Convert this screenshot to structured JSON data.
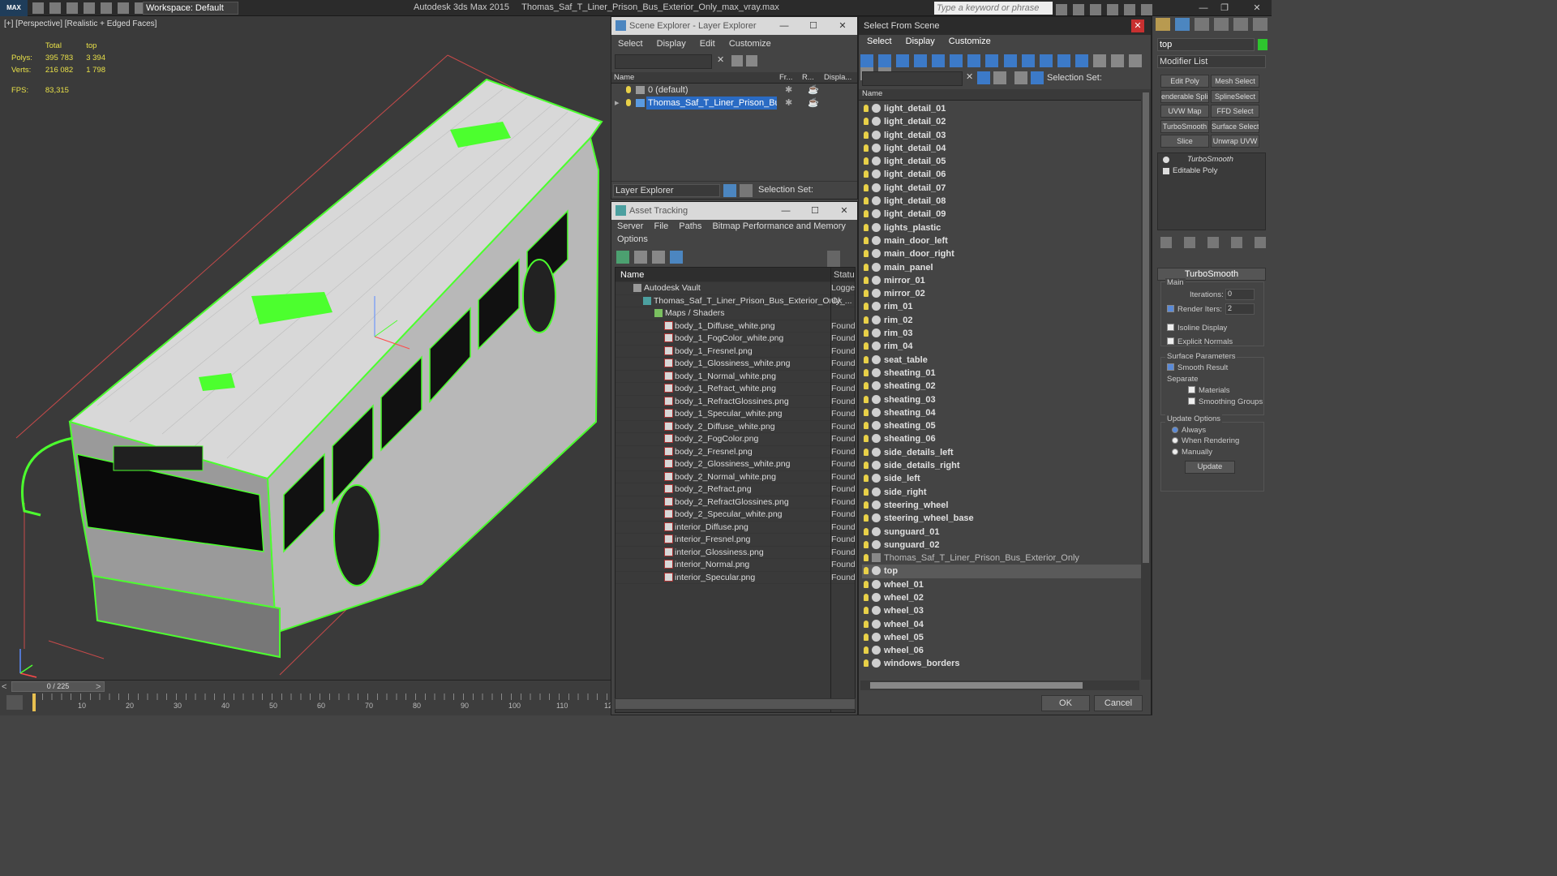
{
  "titlebar": {
    "logo": "MAX",
    "workspace": "Workspace: Default",
    "app_title": "Autodesk 3ds Max  2015",
    "file_title": "Thomas_Saf_T_Liner_Prison_Bus_Exterior_Only_max_vray.max",
    "search_placeholder": "Type a keyword or phrase"
  },
  "viewport": {
    "label": "[+] [Perspective] [Realistic + Edged Faces]",
    "stats": {
      "col_total": "Total",
      "col_top": "top",
      "polys_label": "Polys:",
      "polys_total": "395 783",
      "polys_top": "3 394",
      "verts_label": "Verts:",
      "verts_total": "216 082",
      "verts_top": "1 798",
      "fps_label": "FPS:",
      "fps_value": "83,315"
    }
  },
  "timeline": {
    "frame": "0 / 225",
    "ticks": [
      "10",
      "20",
      "30",
      "40",
      "50",
      "60",
      "70",
      "80",
      "90",
      "100",
      "110",
      "12"
    ]
  },
  "scene_explorer": {
    "title": "Scene Explorer - Layer Explorer",
    "menu": [
      "Select",
      "Display",
      "Edit",
      "Customize"
    ],
    "columns": [
      "Name",
      "Fr...",
      "R...",
      "Displa..."
    ],
    "rows": [
      "0 (default)",
      "Thomas_Saf_T_Liner_Prison_Bus_Ext..."
    ],
    "footer_dropdown": "Layer Explorer",
    "selection_set": "Selection Set:"
  },
  "asset_tracking": {
    "title": "Asset Tracking",
    "menu1": [
      "Server",
      "File",
      "Paths",
      "Bitmap Performance and Memory"
    ],
    "menu2": "Options",
    "col_name": "Name",
    "col_status": "Status",
    "vault": {
      "name": "Autodesk Vault",
      "status": "Logge"
    },
    "file": {
      "name": "Thomas_Saf_T_Liner_Prison_Bus_Exterior_Only_...",
      "status": "Ok"
    },
    "group": "Maps / Shaders",
    "maps": [
      "body_1_Diffuse_white.png",
      "body_1_FogColor_white.png",
      "body_1_Fresnel.png",
      "body_1_Glossiness_white.png",
      "body_1_Normal_white.png",
      "body_1_Refract_white.png",
      "body_1_RefractGlossines.png",
      "body_1_Specular_white.png",
      "body_2_Diffuse_white.png",
      "body_2_FogColor.png",
      "body_2_Fresnel.png",
      "body_2_Glossiness_white.png",
      "body_2_Normal_white.png",
      "body_2_Refract.png",
      "body_2_RefractGlossines.png",
      "body_2_Specular_white.png",
      "interior_Diffuse.png",
      "interior_Fresnel.png",
      "interior_Glossiness.png",
      "interior_Normal.png",
      "interior_Specular.png"
    ],
    "found": "Found"
  },
  "select_from_scene": {
    "title": "Select From Scene",
    "menu": [
      "Select",
      "Display",
      "Customize"
    ],
    "selection_set": "Selection Set:",
    "col_name": "Name",
    "objects": [
      "light_detail_01",
      "light_detail_02",
      "light_detail_03",
      "light_detail_04",
      "light_detail_05",
      "light_detail_06",
      "light_detail_07",
      "light_detail_08",
      "light_detail_09",
      "lights_plastic",
      "main_door_left",
      "main_door_right",
      "main_panel",
      "mirror_01",
      "mirror_02",
      "rim_01",
      "rim_02",
      "rim_03",
      "rim_04",
      "seat_table",
      "sheating_01",
      "sheating_02",
      "sheating_03",
      "sheating_04",
      "sheating_05",
      "sheating_06",
      "side_details_left",
      "side_details_right",
      "side_left",
      "side_right",
      "steering_wheel",
      "steering_wheel_base",
      "sunguard_01",
      "sunguard_02",
      "Thomas_Saf_T_Liner_Prison_Bus_Exterior_Only",
      "top",
      "wheel_01",
      "wheel_02",
      "wheel_03",
      "wheel_04",
      "wheel_05",
      "wheel_06",
      "windows_borders"
    ],
    "ok": "OK",
    "cancel": "Cancel"
  },
  "command_panel": {
    "object_name": "top",
    "modifier_list": "Modifier List",
    "buttons": [
      "Edit Poly",
      "Mesh Select",
      "enderable Splin",
      "SplineSelect",
      "UVW Map",
      "FFD Select",
      "TurboSmooth",
      "Surface Select",
      "Slice",
      "Unwrap UVW"
    ],
    "stack": [
      "TurboSmooth",
      "Editable Poly"
    ],
    "rollout_title": "TurboSmooth",
    "main_label": "Main",
    "iterations_label": "Iterations:",
    "iterations_value": "0",
    "render_iters_label": "Render Iters:",
    "render_iters_value": "2",
    "isoline": "Isoline Display",
    "explicit": "Explicit Normals",
    "surface_params": "Surface Parameters",
    "smooth_result": "Smooth Result",
    "separate": "Separate",
    "materials": "Materials",
    "smoothing_groups": "Smoothing Groups",
    "update_options": "Update Options",
    "always": "Always",
    "when_rendering": "When Rendering",
    "manually": "Manually",
    "update": "Update"
  }
}
